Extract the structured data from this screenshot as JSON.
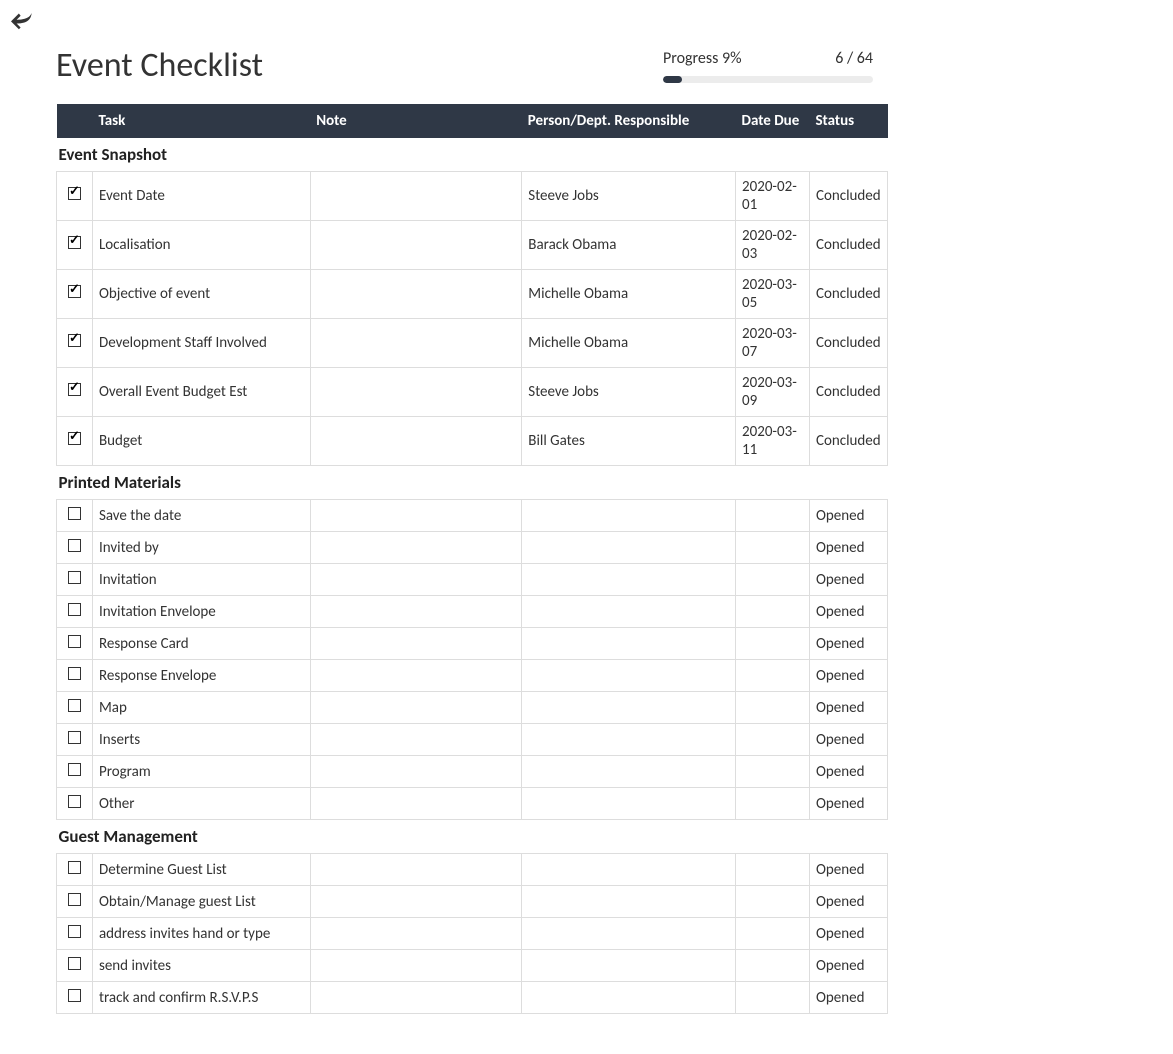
{
  "title": "Event Checklist",
  "progress": {
    "label": "Progress 9%",
    "count": "6 / 64",
    "percent": 9
  },
  "columns": {
    "check": "",
    "task": "Task",
    "note": "Note",
    "person": "Person/Dept. Responsible",
    "date": "Date Due",
    "status": "Status"
  },
  "sections": [
    {
      "name": "Event Snapshot",
      "rows": [
        {
          "checked": true,
          "task": "Event Date",
          "note": "",
          "person": "Steeve Jobs",
          "date": "2020-02-01",
          "status": "Concluded"
        },
        {
          "checked": true,
          "task": "Localisation",
          "note": "",
          "person": "Barack Obama",
          "date": "2020-02-03",
          "status": "Concluded"
        },
        {
          "checked": true,
          "task": "Objective of event",
          "note": "",
          "person": "Michelle Obama",
          "date": "2020-03-05",
          "status": "Concluded"
        },
        {
          "checked": true,
          "task": "Development Staff Involved",
          "note": "",
          "person": "Michelle Obama",
          "date": "2020-03-07",
          "status": "Concluded"
        },
        {
          "checked": true,
          "task": "Overall Event Budget Est",
          "note": "",
          "person": "Steeve Jobs",
          "date": "2020-03-09",
          "status": "Concluded"
        },
        {
          "checked": true,
          "task": "Budget",
          "note": "",
          "person": "Bill Gates",
          "date": "2020-03-11",
          "status": "Concluded"
        }
      ]
    },
    {
      "name": "Printed Materials",
      "rows": [
        {
          "checked": false,
          "task": "Save the date",
          "note": "",
          "person": "",
          "date": "",
          "status": "Opened"
        },
        {
          "checked": false,
          "task": "Invited by",
          "note": "",
          "person": "",
          "date": "",
          "status": "Opened"
        },
        {
          "checked": false,
          "task": "Invitation",
          "note": "",
          "person": "",
          "date": "",
          "status": "Opened"
        },
        {
          "checked": false,
          "task": "Invitation Envelope",
          "note": "",
          "person": "",
          "date": "",
          "status": "Opened"
        },
        {
          "checked": false,
          "task": "Response Card",
          "note": "",
          "person": "",
          "date": "",
          "status": "Opened"
        },
        {
          "checked": false,
          "task": "Response Envelope",
          "note": "",
          "person": "",
          "date": "",
          "status": "Opened"
        },
        {
          "checked": false,
          "task": "Map",
          "note": "",
          "person": "",
          "date": "",
          "status": "Opened"
        },
        {
          "checked": false,
          "task": "Inserts",
          "note": "",
          "person": "",
          "date": "",
          "status": "Opened"
        },
        {
          "checked": false,
          "task": "Program",
          "note": "",
          "person": "",
          "date": "",
          "status": "Opened"
        },
        {
          "checked": false,
          "task": "Other",
          "note": "",
          "person": "",
          "date": "",
          "status": "Opened"
        }
      ]
    },
    {
      "name": "Guest Management",
      "rows": [
        {
          "checked": false,
          "task": "Determine Guest List",
          "note": "",
          "person": "",
          "date": "",
          "status": "Opened"
        },
        {
          "checked": false,
          "task": "Obtain/Manage guest List",
          "note": "",
          "person": "",
          "date": "",
          "status": "Opened"
        },
        {
          "checked": false,
          "task": "address invites hand or type",
          "note": "",
          "person": "",
          "date": "",
          "status": "Opened"
        },
        {
          "checked": false,
          "task": "send invites",
          "note": "",
          "person": "",
          "date": "",
          "status": "Opened"
        },
        {
          "checked": false,
          "task": "track and confirm R.S.V.P.S",
          "note": "",
          "person": "",
          "date": "",
          "status": "Opened"
        }
      ]
    }
  ]
}
